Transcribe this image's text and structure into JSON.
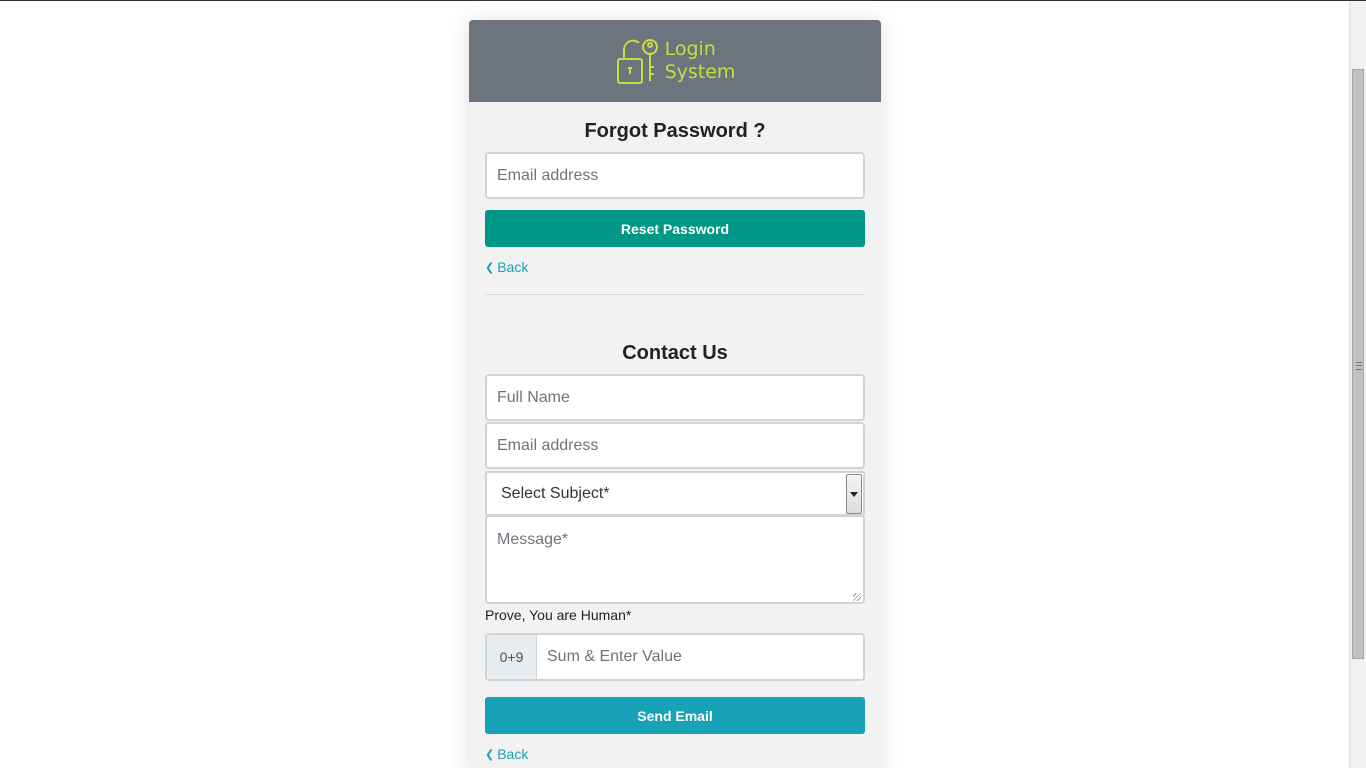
{
  "logo": {
    "line1": "Login",
    "line2": "System",
    "icon": "padlock-key-icon",
    "color": "#c8dc3c"
  },
  "forgot": {
    "title": "Forgot Password ?",
    "email_placeholder": "Email address",
    "reset_label": "Reset Password",
    "back_label": "Back"
  },
  "contact": {
    "title": "Contact Us",
    "name_placeholder": "Full Name",
    "email_placeholder": "Email address",
    "subject_selected": "Select Subject*",
    "message_placeholder": "Message*",
    "captcha_label": "Prove, You are Human*",
    "captcha_sum": "0+9",
    "captcha_placeholder": "Sum & Enter Value",
    "send_label": "Send Email",
    "back_label": "Back"
  },
  "colors": {
    "header": "#6c757d",
    "reset_button": "#009688",
    "send_button": "#17a2b8",
    "link": "#17a2b8"
  }
}
